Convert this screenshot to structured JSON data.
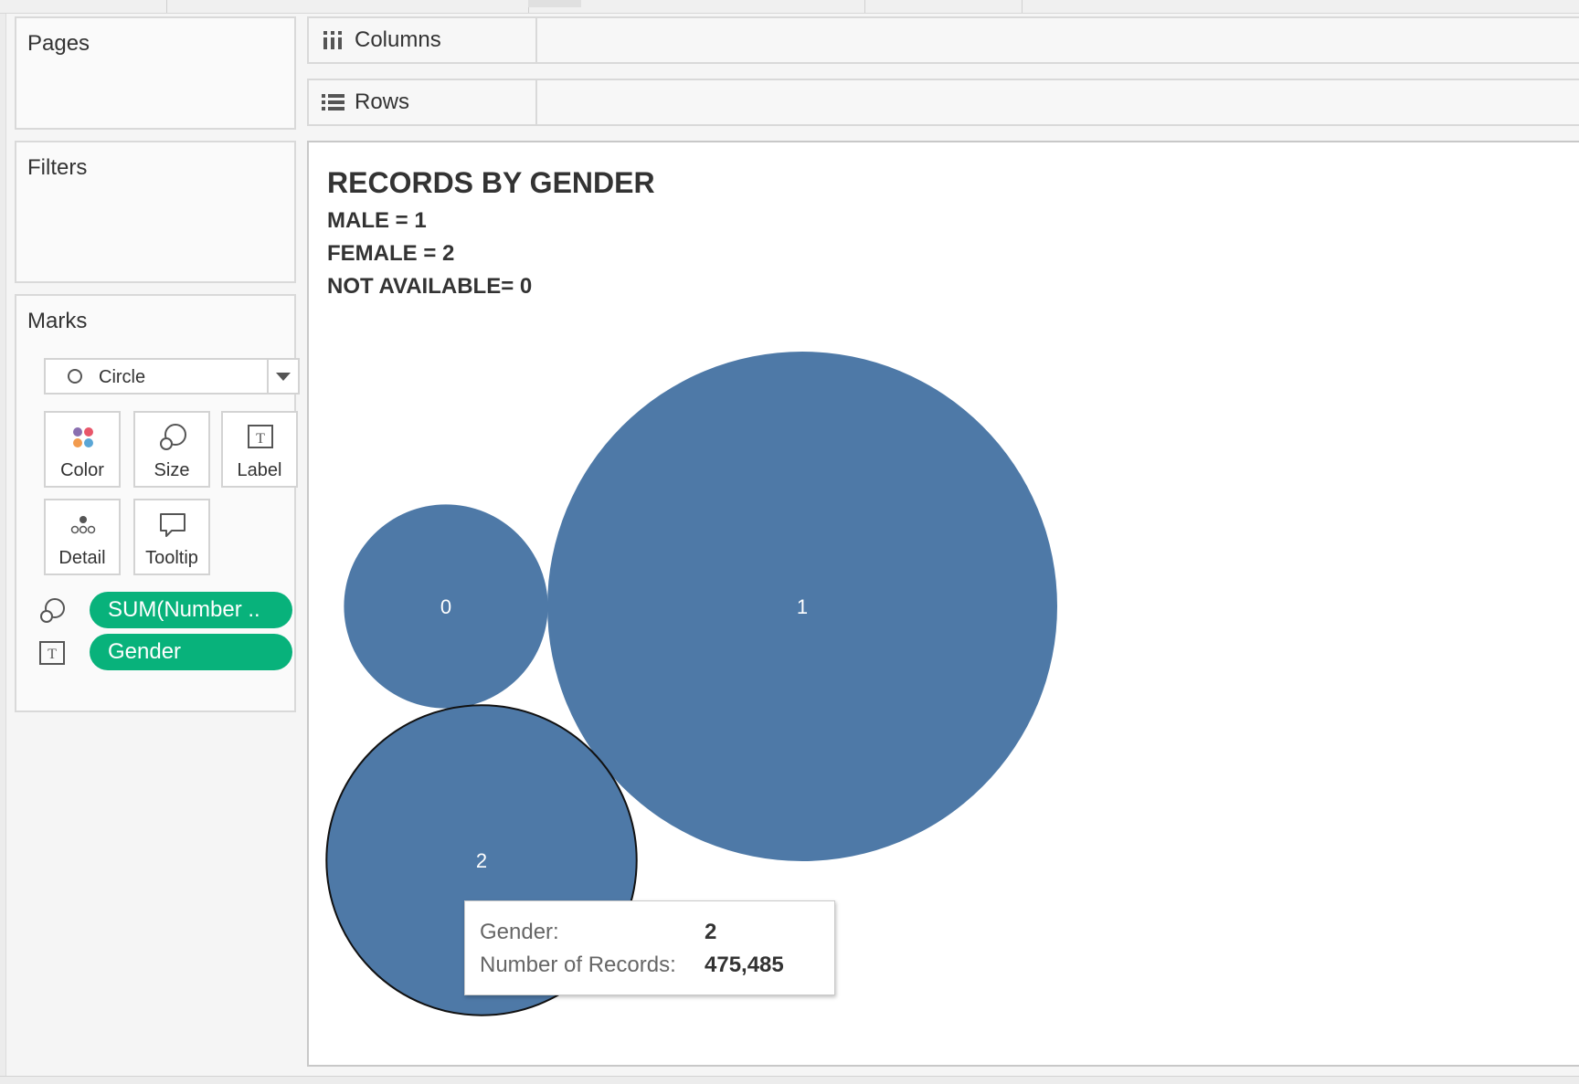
{
  "panels": {
    "pages_title": "Pages",
    "filters_title": "Filters",
    "marks_title": "Marks"
  },
  "shelves": {
    "columns_label": "Columns",
    "rows_label": "Rows"
  },
  "marks": {
    "mark_type": "Circle",
    "buttons": {
      "color": "Color",
      "size": "Size",
      "label": "Label",
      "detail": "Detail",
      "tooltip": "Tooltip"
    },
    "pills": {
      "size_field": "SUM(Number ..",
      "label_field": "Gender"
    },
    "pill_color": "#08b27b"
  },
  "viz": {
    "title": "RECORDS BY GENDER",
    "subtitles": [
      "MALE = 1",
      "FEMALE = 2",
      "NOT AVAILABLE= 0"
    ]
  },
  "chart_data": {
    "type": "packed-bubble",
    "mark_color": "#4e79a7",
    "categories": [
      "0",
      "1",
      "2"
    ],
    "bubbles": [
      {
        "label": "0",
        "relative_size": 0.16
      },
      {
        "label": "1",
        "relative_size": 1.0
      },
      {
        "label": "2",
        "relative_size": 0.37,
        "value": 475485,
        "highlighted": true
      }
    ]
  },
  "tooltip": {
    "gender_key": "Gender:",
    "gender_value": "2",
    "records_key": "Number of Records:",
    "records_value": "475,485"
  }
}
